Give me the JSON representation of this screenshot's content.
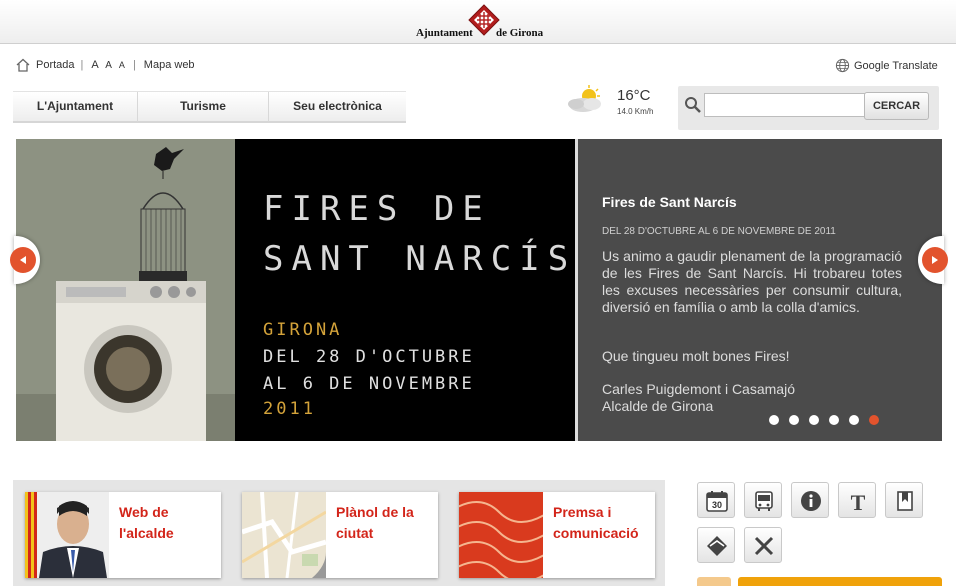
{
  "header": {
    "logo_left": "Ajuntament",
    "logo_right": "de Girona"
  },
  "utility": {
    "home_label": "Portada",
    "separator": "|",
    "font_sizes": [
      "A",
      "A",
      "A"
    ],
    "sitemap": "Mapa web",
    "translate": "Google Translate"
  },
  "nav": {
    "items": [
      {
        "label": "L'Ajuntament"
      },
      {
        "label": "Turisme"
      },
      {
        "label": "Seu electrònica"
      }
    ]
  },
  "weather": {
    "temperature": "16°C",
    "wind": "14.0 Km/h",
    "icon": "partly-cloudy-icon"
  },
  "search": {
    "placeholder": "",
    "value": "",
    "button": "CERCAR"
  },
  "slider": {
    "poster_line1": "FIRES DE",
    "poster_line2": "SANT NARCÍS",
    "poster_city": "GIRONA",
    "poster_dates1": "DEL 28 D'OCTUBRE",
    "poster_dates2": "AL 6 DE NOVEMBRE",
    "poster_year": "2011",
    "title": "Fires de Sant Narcís",
    "date": "DEL 28 D'OCTUBRE AL 6 DE NOVEMBRE DE 2011",
    "body": "Us animo a gaudir plenament de la programació de les Fires de Sant Narcís. Hi trobareu totes les excuses necessàries per consumir cultura, diversió en família o amb la colla d'amics.",
    "wish": "Que tingueu molt bones Fires!",
    "signature_name": "Carles Puigdemont i Casamajó",
    "signature_role": "Alcalde de Girona",
    "dot_count": 6,
    "active_dot": 6
  },
  "promos": [
    {
      "line1": "Web de",
      "line2": "l'alcalde"
    },
    {
      "line1": "Plànol de la",
      "line2": "ciutat"
    },
    {
      "line1": "Premsa i",
      "line2": "comunicació"
    }
  ],
  "tools": [
    {
      "icon": "calendar-icon",
      "day": "30"
    },
    {
      "icon": "bus-icon"
    },
    {
      "icon": "info-icon"
    },
    {
      "icon": "text-size-icon",
      "glyph": "T"
    },
    {
      "icon": "bookmark-icon"
    },
    {
      "icon": "envelope-icon"
    },
    {
      "icon": "tools-icon"
    }
  ],
  "colors": {
    "accent": "#e2532d",
    "promo_red": "#d3251a",
    "poster_gold": "#d4a33a",
    "panel_gray": "#4b4b4b",
    "orange_bar": "#f0a20a"
  }
}
